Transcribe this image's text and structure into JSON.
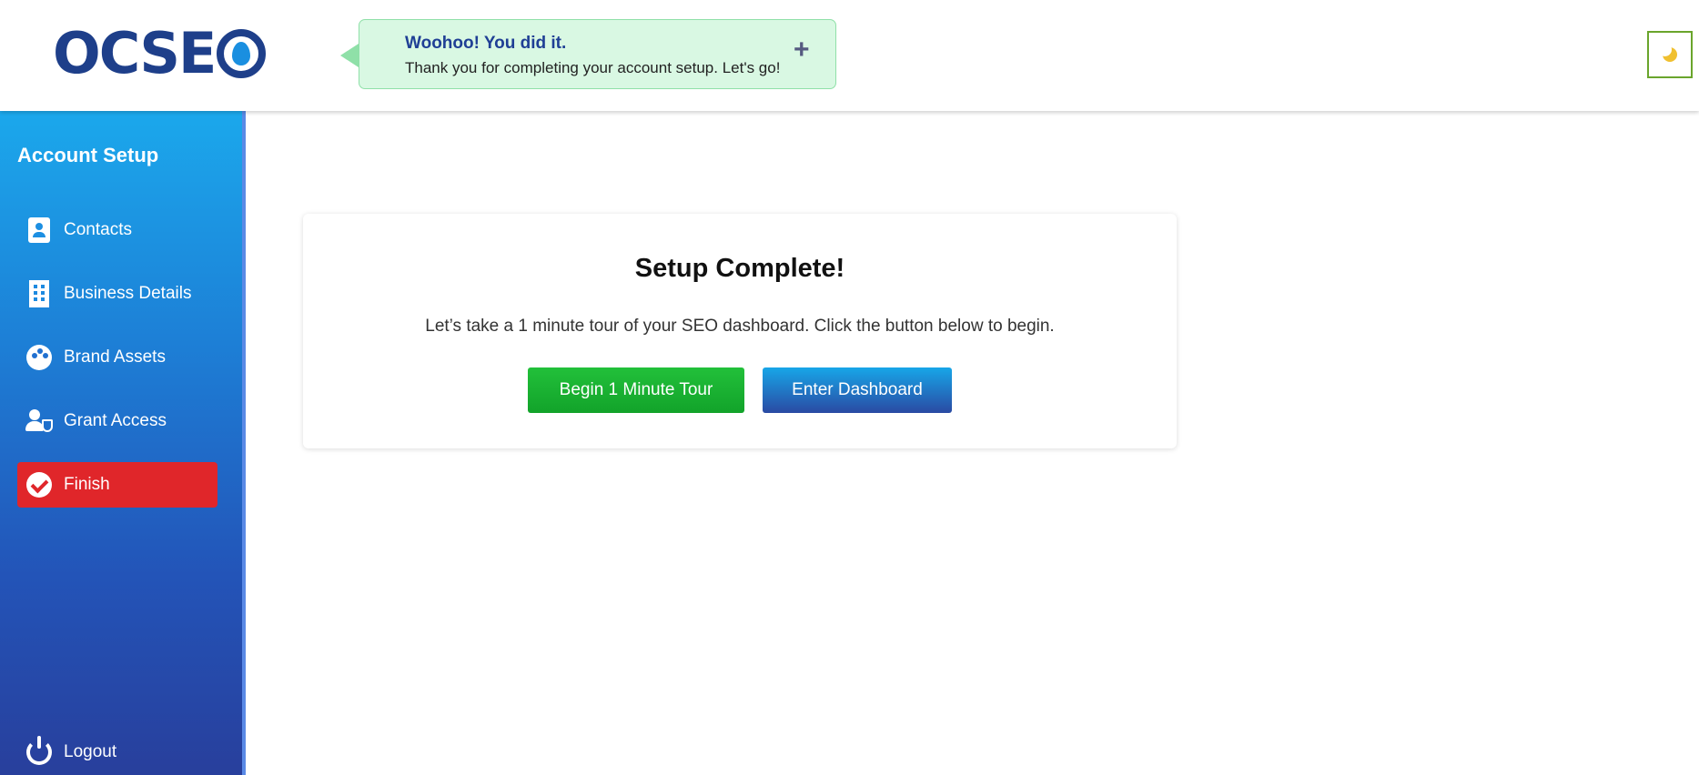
{
  "header": {
    "logo_text": "OCSE",
    "theme_toggle_icon": "moon-icon"
  },
  "toast": {
    "title": "Woohoo! You did it.",
    "message": "Thank you for completing your account setup. Let's go!",
    "close_symbol": "+"
  },
  "sidebar": {
    "title": "Account Setup",
    "items": [
      {
        "label": "Contacts",
        "icon": "contacts-icon"
      },
      {
        "label": "Business Details",
        "icon": "building-icon"
      },
      {
        "label": "Brand Assets",
        "icon": "palette-icon"
      },
      {
        "label": "Grant Access",
        "icon": "user-shield-icon"
      },
      {
        "label": "Finish",
        "icon": "check-circle-icon",
        "active": true
      }
    ],
    "logout_label": "Logout"
  },
  "main": {
    "card_title": "Setup Complete!",
    "card_text": "Let’s take a 1 minute tour of your SEO dashboard. Click the button below to begin.",
    "tour_button": "Begin 1 Minute Tour",
    "dashboard_button": "Enter Dashboard"
  },
  "colors": {
    "brand_navy": "#1e3f8a",
    "active_red": "#e0262a",
    "success_green": "#12a32a",
    "toast_bg": "#d9f8e3"
  }
}
